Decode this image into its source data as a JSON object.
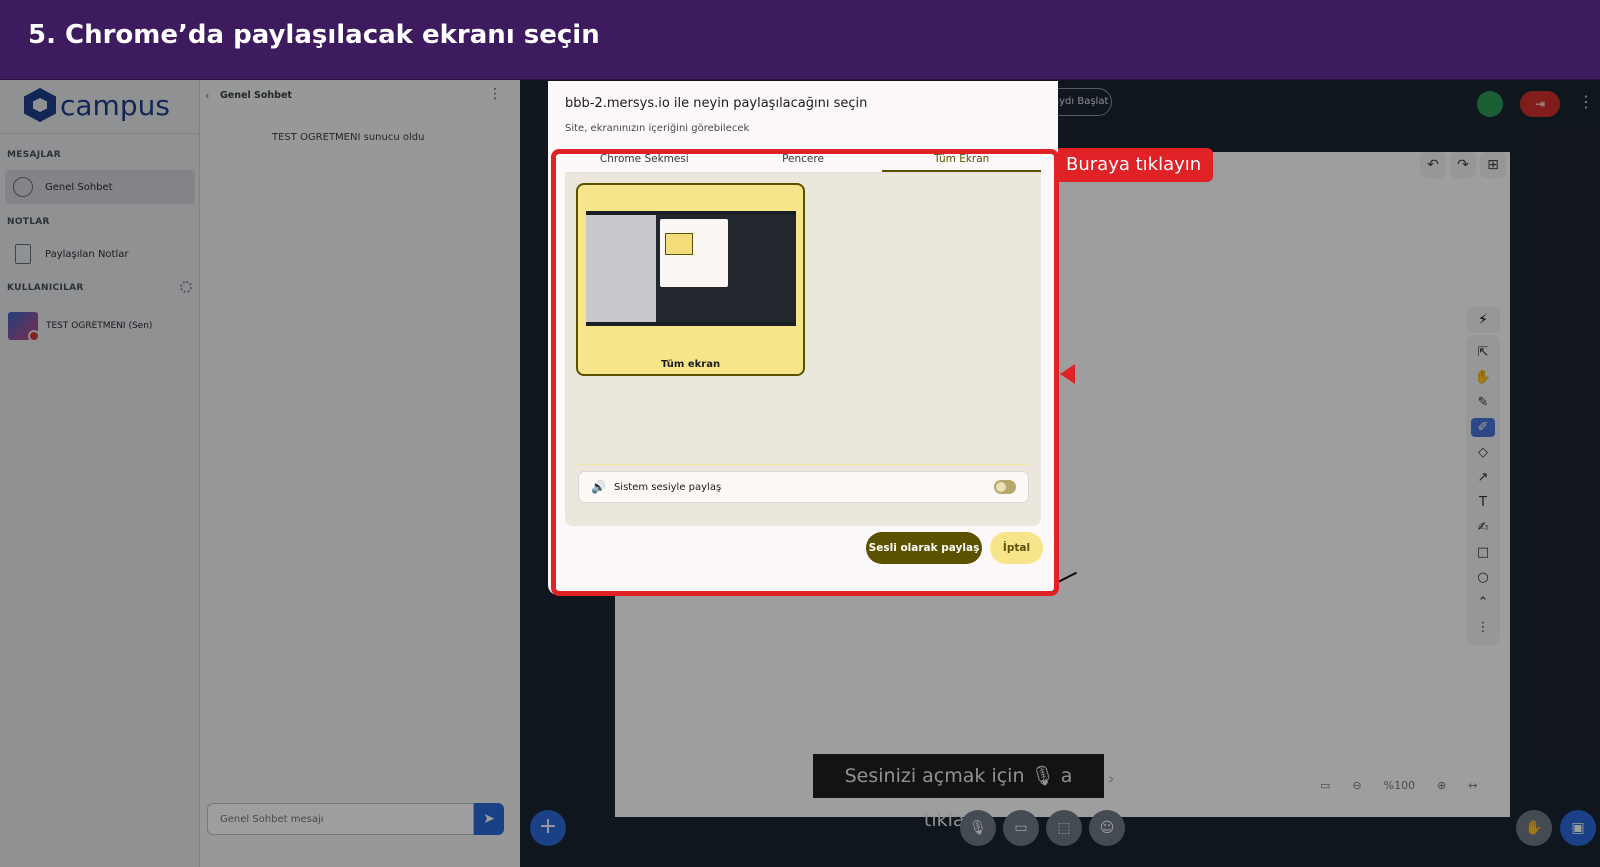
{
  "banner": {
    "title": "5. Chrome’da paylaşılacak ekranı seçin"
  },
  "sidebar": {
    "logo_text": "campus",
    "sections": {
      "messages": "MESAJLAR",
      "notes": "NOTLAR",
      "users": "KULLANICILAR"
    },
    "items": [
      {
        "label": "Genel Sohbet",
        "active": true
      },
      {
        "label": "Paylaşılan Notlar",
        "active": false
      }
    ],
    "user": {
      "name": "TEST OGRETMENI (Sen)"
    }
  },
  "chat": {
    "back_label": "Genel Sohbet",
    "system_message": "TEST OGRETMENI sunucu oldu",
    "input_placeholder": "Genel Sohbet mesajı",
    "send_icon": "send-icon"
  },
  "stage": {
    "record_label": "aydı Başlat",
    "caption": "Sesinizi açmak için",
    "caption_suffix": "a tıklayın",
    "zoom": "%100"
  },
  "dialog": {
    "title": "bbb-2.mersys.io ile neyin paylaşılacağını seçin",
    "subtitle": "Site, ekranınızın içeriğini görebilecek",
    "tabs": [
      "Chrome Sekmesi",
      "Pencere",
      "Tüm Ekran"
    ],
    "active_tab": "Tüm Ekran",
    "thumbnail_label": "Tüm ekran",
    "audio_label": "Sistem sesiyle paylaş",
    "audio_on": false,
    "share_button": "Sesli olarak paylaş",
    "cancel_button": "İptal"
  },
  "callout": {
    "text": "Buraya tıklayın"
  },
  "colors": {
    "banner": "#3e1a5e",
    "highlight": "#e02126",
    "chrome_accent": "#5b5200",
    "chrome_tile": "#f7e589",
    "bbb_blue": "#2b68d8"
  }
}
